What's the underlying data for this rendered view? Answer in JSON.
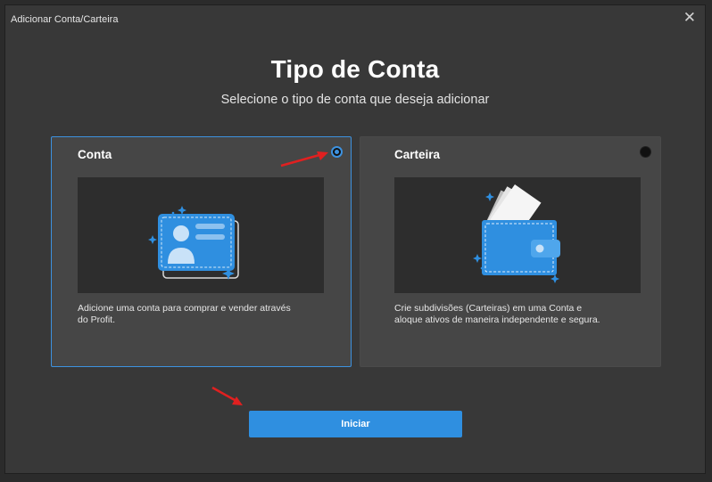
{
  "window": {
    "title": "Adicionar Conta/Carteira"
  },
  "header": {
    "title": "Tipo de Conta",
    "subtitle": "Selecione o tipo de conta que deseja adicionar"
  },
  "options": [
    {
      "title": "Conta",
      "description_line1": "Adicione uma conta para comprar e vender através",
      "description_line2": "do Profit.",
      "selected": true,
      "icon": "id-card-icon"
    },
    {
      "title": "Carteira",
      "description_line1": "Crie subdivisões (Carteiras) em uma Conta e",
      "description_line2": "aloque ativos de maneira independente e segura.",
      "selected": false,
      "icon": "wallet-icon"
    }
  ],
  "actions": {
    "start_label": "Iniciar"
  },
  "colors": {
    "accent": "#2f8fe0",
    "annotation_arrow": "#e02020",
    "background": "#383838",
    "card": "#464646"
  }
}
